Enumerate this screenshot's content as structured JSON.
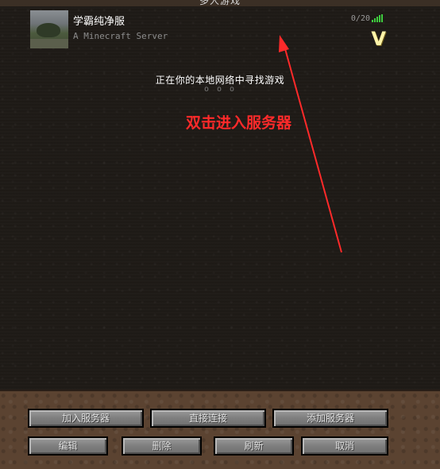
{
  "screen": {
    "title": "多人游戏"
  },
  "server": {
    "name": "学霸纯净服",
    "motd": "A Minecraft Server",
    "players": "0/20",
    "icon": "server-landscape-icon",
    "signal_icon": "signal-bars-icon",
    "signal_color": "#3ecc3e"
  },
  "lan": {
    "searching": "正在你的本地网络中寻找游戏",
    "dots": "o o o"
  },
  "annotation": {
    "text": "双击进入服务器",
    "color": "#ff2a2a"
  },
  "buttons": {
    "join_server": "加入服务器",
    "direct_connect": "直接连接",
    "add_server": "添加服务器",
    "edit": "编辑",
    "delete": "删除",
    "refresh": "刷新",
    "cancel": "取消"
  },
  "check_mark": "V"
}
